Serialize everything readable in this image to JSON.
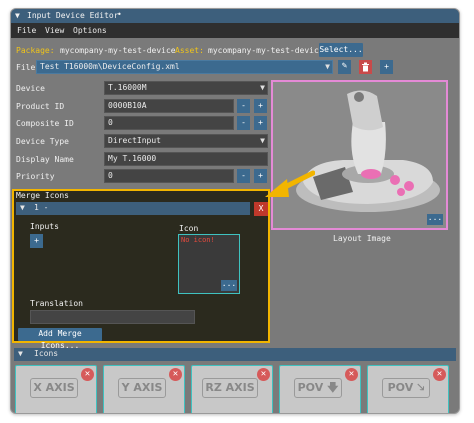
{
  "window": {
    "title": "Input Device Editor"
  },
  "menu": [
    "File",
    "View",
    "Options"
  ],
  "package_row": {
    "package_label": "Package:",
    "package_value": "mycompany-my-test-device",
    "asset_label": "Asset:",
    "asset_value": "mycompany-my-test-device",
    "select_label": "Select..."
  },
  "file_row": {
    "label": "File",
    "value": "Test T16000m\\DeviceConfig.xml"
  },
  "properties": [
    {
      "label": "Device",
      "value": "T.16000M",
      "kind": "combo"
    },
    {
      "label": "Product ID",
      "value": "0000B10A",
      "kind": "stepper"
    },
    {
      "label": "Composite ID",
      "value": "0",
      "kind": "stepper"
    },
    {
      "label": "Device Type",
      "value": "DirectInput",
      "kind": "combo"
    },
    {
      "label": "Display Name",
      "value": "My T.16000",
      "kind": "text"
    },
    {
      "label": "Priority",
      "value": "0",
      "kind": "stepper"
    }
  ],
  "layout_image": {
    "caption": "Layout Image",
    "more": "..."
  },
  "merge_icons": {
    "title": "Merge Icons",
    "item_title": "1 -",
    "delete": "X",
    "inputs_label": "Inputs",
    "add_input": "+",
    "icon_label": "Icon",
    "icon_missing": "No icon!",
    "icon_more": "...",
    "translation_label": "Translation",
    "translation_value": "",
    "add_button": "Add Merge Icons..."
  },
  "icons_section": {
    "title": "Icons",
    "tiles": [
      {
        "label": "X AXIS",
        "glyph": ""
      },
      {
        "label": "Y AXIS",
        "glyph": ""
      },
      {
        "label": "RZ AXIS",
        "glyph": ""
      },
      {
        "label": "POV",
        "glyph": "🡇"
      },
      {
        "label": "POV",
        "glyph": "🡖"
      }
    ]
  },
  "colors": {
    "accent_blue": "#3c6a8f",
    "highlight_yellow": "#f2b500",
    "cyan_border": "#3fc2c0",
    "pink_border": "#e48ad6",
    "delete_red": "#c0392b"
  }
}
